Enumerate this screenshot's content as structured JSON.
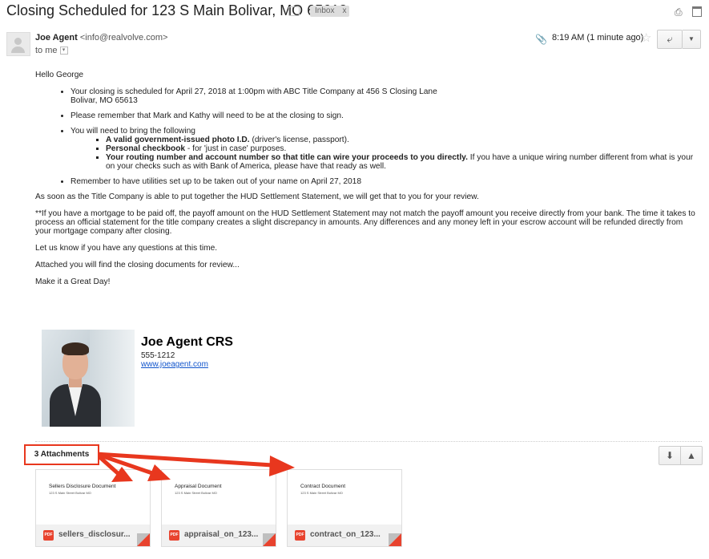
{
  "header": {
    "subject": "Closing Scheduled for 123 S Main Bolivar, MO 65613",
    "label": "Inbox",
    "label_remove": "x"
  },
  "sender": {
    "name": "Joe Agent",
    "email": "<info@realvolve.com>",
    "to": "to me",
    "time": "8:19 AM (1 minute ago)"
  },
  "body": {
    "greeting": "Hello George",
    "bullets": [
      "Your closing is scheduled for April 27, 2018 at 1:00pm  with ABC Title Company at 456 S Closing Lane",
      "Bolivar, MO 65613",
      "Please remember that Mark and Kathy will need to be at the closing to sign.",
      "You will need to bring the following",
      "Remember to have utilities set up to be taken out of your name on April 27, 2018"
    ],
    "sub_bullets": [
      {
        "bold": "A valid government-issued photo I.D.",
        "rest": " (driver's license, passport)."
      },
      {
        "bold": "Personal checkbook",
        "rest": " - for 'just in case' purposes."
      },
      {
        "bold": "Your routing number and account number so that title can wire your proceeds to you directly.",
        "rest": " If you have a unique wiring number different from what is your on your checks such as with Bank of America, please have that ready as well."
      }
    ],
    "paragraphs": [
      "As soon as the Title Company is able to put together the HUD Settlement Statement, we will get that to you for your review.",
      "**If you have a mortgage to be paid off, the payoff amount on the HUD Settlement Statement may not match the payoff amount you receive directly from your bank. The time it takes to process an official statement for the title company creates a slight discrepancy in amounts. Any differences and any money left in your escrow account will be refunded directly from your mortgage company after closing.",
      "Let us know if you have any questions at this time.",
      "Attached you will find the closing documents for review...",
      "Make it a Great Day!"
    ]
  },
  "signature": {
    "name": "Joe Agent CRS",
    "phone": "555-1212",
    "url": "www.joeagent.com"
  },
  "attachments": {
    "count_label": "3 Attachments",
    "items": [
      {
        "preview_title": "Sellers Disclosure Document",
        "preview_line": "123 S Main Street Bolivar MO",
        "filename": "sellers_disclosur...",
        "type": "PDF"
      },
      {
        "preview_title": "Appraisal Document",
        "preview_line": "123 S Main Street Bolivar MO",
        "filename": "appraisal_on_123...",
        "type": "PDF"
      },
      {
        "preview_title": "Contract Document",
        "preview_line": "123 S Main Street Bolivar MO",
        "filename": "contract_on_123...",
        "type": "PDF"
      }
    ]
  },
  "icons": {
    "print": "print-icon",
    "new_window": "new-window-icon",
    "attachment": "paperclip-icon",
    "star": "star-icon",
    "reply": "reply-icon",
    "more": "chevron-down-icon",
    "download": "download-icon",
    "drive": "drive-icon"
  },
  "colors": {
    "annotation": "#e8371e",
    "pdf": "#e8432e",
    "link": "#1155cc"
  }
}
